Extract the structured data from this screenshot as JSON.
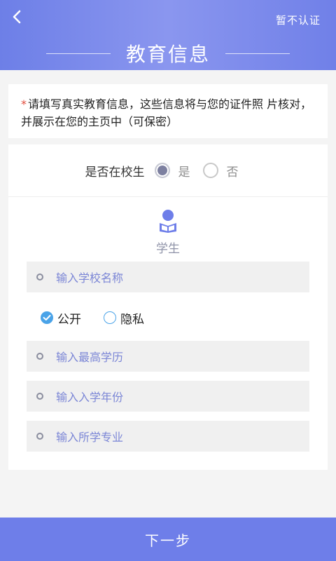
{
  "header": {
    "title": "教育信息",
    "skip_label": "暂不认证",
    "back_icon": "chevron-left-icon"
  },
  "notice": {
    "star": "*",
    "text": "请填写真实教育信息，这些信息将与您的证件照 片核对，并展示在您的主页中（可保密）"
  },
  "school_status": {
    "label": "是否在校生",
    "options": [
      {
        "label": "是",
        "selected": true
      },
      {
        "label": "否",
        "selected": false
      }
    ]
  },
  "student": {
    "icon": "student-reading-icon",
    "label": "学生"
  },
  "fields": {
    "school_name": "输入学校名称",
    "highest_degree": "输入最高学历",
    "enroll_year": "输入入学年份",
    "major": "输入所学专业"
  },
  "privacy": {
    "public_label": "公开",
    "private_label": "隐私",
    "selected": "public"
  },
  "footer": {
    "next_label": "下一步"
  },
  "colors": {
    "accent": "#6e7ee9",
    "checkbox": "#4aa3e8",
    "required_star": "#e24b3b"
  }
}
